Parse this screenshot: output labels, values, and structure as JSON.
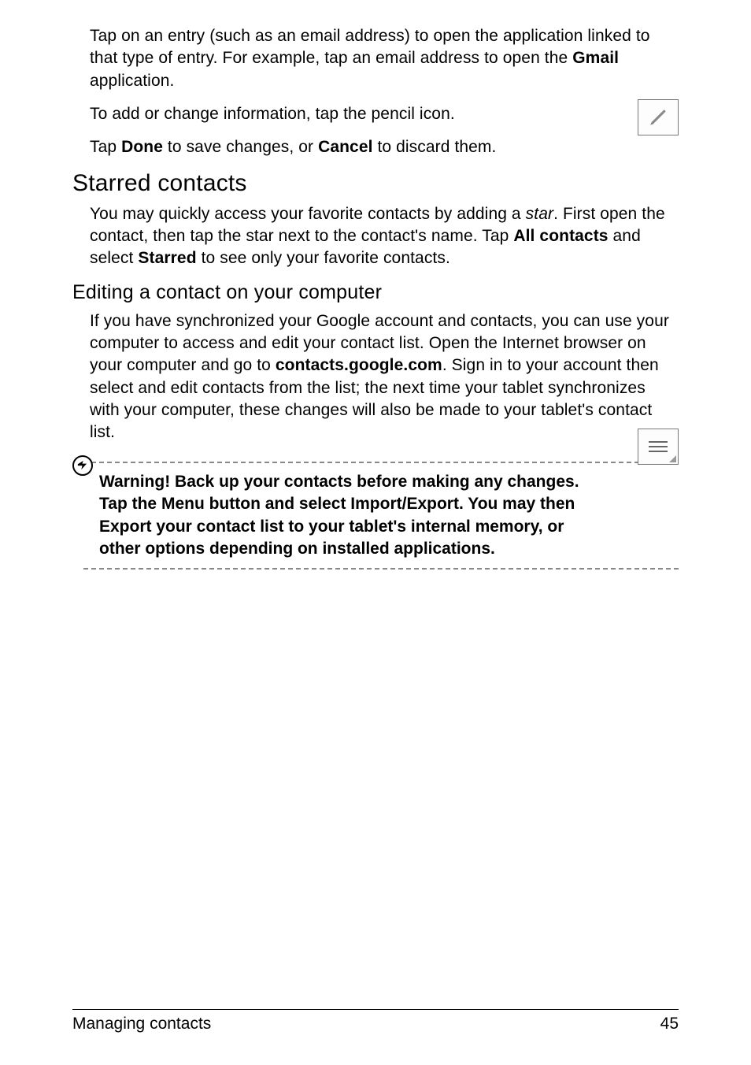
{
  "intro": {
    "p1_pre": "Tap on an entry (such as an email address) to open the application linked to that type of entry. For example, tap an email address to open the ",
    "p1_bold": "Gmail",
    "p1_post": " application.",
    "p2": "To add or change information, tap the pencil icon.",
    "p3_pre": "Tap ",
    "p3_b1": "Done",
    "p3_mid": " to save changes, or ",
    "p3_b2": "Cancel",
    "p3_post": " to discard them."
  },
  "section1": {
    "heading": "Starred contacts",
    "p_pre": "You may quickly access your favorite contacts by adding a ",
    "p_it": "star",
    "p_mid1": ". First open the contact, then tap the star next to the contact's name. Tap ",
    "p_b1": "All contacts",
    "p_mid2": "  and select ",
    "p_b2": "Starred",
    "p_post": " to see only your favorite contacts."
  },
  "section2": {
    "heading": "Editing a contact on your computer",
    "p_pre": "If you have synchronized your Google account and contacts, you can use your computer to access and edit your contact list. Open the Internet browser on your computer and go to ",
    "p_b1": "contacts.google.com",
    "p_post": ". Sign in to your account then select and edit contacts from the list; the next time your tablet synchronizes with your computer, these changes will also be made to your tablet's contact list."
  },
  "warning": {
    "text": "Warning! Back up your contacts before making any changes. Tap the Menu button and select Import/Export. You may then Export your contact list to your tablet's internal memory, or other options depending on installed applications."
  },
  "footer": {
    "left": "Managing contacts",
    "right": "45"
  }
}
